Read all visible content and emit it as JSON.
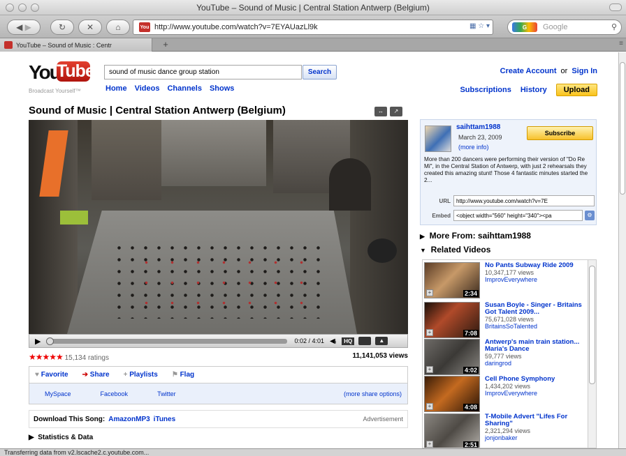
{
  "browser": {
    "window_title": "YouTube – Sound of Music | Central Station Antwerp (Belgium)",
    "url": "http://www.youtube.com/watch?v=7EYAUazLl9k",
    "search_placeholder": "Google",
    "tab_label": "YouTube – Sound of Music : Centr",
    "new_tab": "+",
    "status": "Transferring data from v2.lscache2.c.youtube.com..."
  },
  "header": {
    "logo_you": "You",
    "logo_tube": "Tube",
    "tagline": "Broadcast Yourself™",
    "search_value": "sound of music dance group station",
    "search_button": "Search",
    "nav": [
      "Home",
      "Videos",
      "Channels",
      "Shows"
    ],
    "create_account": "Create Account",
    "or": "or",
    "sign_in": "Sign In",
    "subscriptions": "Subscriptions",
    "history": "History",
    "upload": "Upload"
  },
  "video": {
    "title": "Sound of Music | Central Station Antwerp (Belgium)",
    "time": "0:02 / 4:01",
    "hq": "HQ",
    "progress": 0.01,
    "stars": "★★★★★",
    "ratings": "15,134 ratings",
    "views": "11,141,053 views"
  },
  "actions": {
    "favorite": "Favorite",
    "share": "Share",
    "playlists": "Playlists",
    "flag": "Flag",
    "myspace": "MySpace",
    "facebook": "Facebook",
    "twitter": "Twitter",
    "more_share": "(more share options)",
    "download_label": "Download This Song:",
    "amazon": "AmazonMP3",
    "itunes": "iTunes",
    "advertisement": "Advertisement",
    "stats": "Statistics & Data"
  },
  "channel": {
    "name": "saihttam1988",
    "date": "March 23, 2009",
    "more_info": "(more info)",
    "subscribe": "Subscribe",
    "description": "More than 200 dancers were performing their version of \"Do Re Mi\", in the Central Station of Antwerp, with just 2 rehearsals they created this amazing stunt! Those 4 fantastic minutes started the 2...",
    "url_label": "URL",
    "url_value": "http://www.youtube.com/watch?v=7E",
    "embed_label": "Embed",
    "embed_value": "<object width=\"560\" height=\"340\"><pa"
  },
  "sidebar": {
    "more_from": "More From: saihttam1988",
    "related_header": "Related Videos",
    "related": [
      {
        "title": "No Pants Subway Ride 2009",
        "views": "10,347,177 views",
        "user": "ImprovEverywhere",
        "duration": "2:34"
      },
      {
        "title": "Susan Boyle - Singer - Britains Got Talent 2009...",
        "views": "75,671,028 views",
        "user": "BritainsSoTalented",
        "duration": "7:08"
      },
      {
        "title": "Antwerp's main train station... Maria's Dance",
        "views": "59,777 views",
        "user": "daringrod",
        "duration": "4:02"
      },
      {
        "title": "Cell Phone Symphony",
        "views": "1,434,202 views",
        "user": "ImprovEverywhere",
        "duration": "4:08"
      },
      {
        "title": "T-Mobile Advert \"Lifes For Sharing\"",
        "views": "2,321,294 views",
        "user": "jonjonbaker",
        "duration": "2:51"
      }
    ]
  },
  "colors": {
    "link": "#0033cc",
    "brand_red": "#c4302b",
    "upload_yellow": "#f9c21b"
  }
}
